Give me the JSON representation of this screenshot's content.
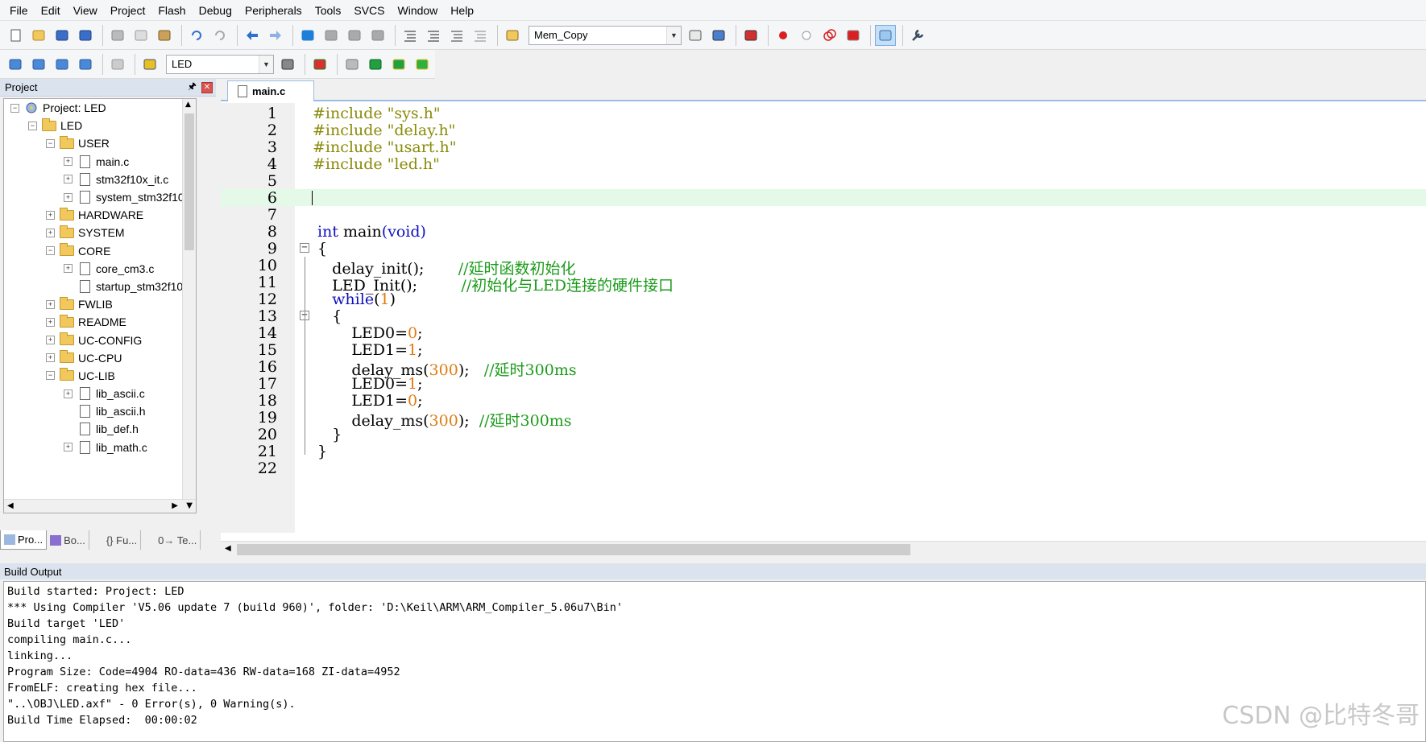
{
  "menu": [
    "File",
    "Edit",
    "View",
    "Project",
    "Flash",
    "Debug",
    "Peripherals",
    "Tools",
    "SVCS",
    "Window",
    "Help"
  ],
  "toolbar1": {
    "icons": [
      "new-file-icon",
      "open-icon",
      "save-icon",
      "save-all-icon",
      "cut-icon",
      "copy-icon",
      "paste-icon",
      "undo-icon",
      "redo-icon",
      "nav-back-icon",
      "nav-forward-icon",
      "bookmark-icon",
      "prev-bookmark-icon",
      "next-bookmark-icon",
      "clear-bookmarks-icon",
      "indent-icon",
      "unindent-icon",
      "comment-icon",
      "uncomment-icon",
      "find-in-files-icon"
    ],
    "find_combo": "Mem_Copy",
    "icons2": [
      "incremental-find-icon",
      "browse-icon",
      "debug-session-icon",
      "breakpoint-icon",
      "disable-breakpoint-icon",
      "disable-all-breakpoints-icon",
      "kill-breakpoints-icon",
      "window-layout-icon",
      "configure-icon"
    ]
  },
  "toolbar2": {
    "icons": [
      "translate-icon",
      "build-icon",
      "rebuild-icon",
      "batch-build-icon",
      "stop-build-icon",
      "download-icon"
    ],
    "target_combo": "LED",
    "icons2": [
      "target-options-icon",
      "manage-components-icon",
      "pack-installer-icon",
      "select-packs-icon",
      "event-recorder-icon",
      "green-diamond-icon"
    ]
  },
  "project": {
    "title": "Project",
    "pin": "⎐",
    "close": "✕",
    "tree": [
      {
        "label": "Project: LED",
        "level": 0,
        "type": "project",
        "exp": "−"
      },
      {
        "label": "LED",
        "level": 1,
        "type": "target",
        "exp": "−"
      },
      {
        "label": "USER",
        "level": 2,
        "type": "folder",
        "exp": "−"
      },
      {
        "label": "main.c",
        "level": 3,
        "type": "file",
        "exp": "+"
      },
      {
        "label": "stm32f10x_it.c",
        "level": 3,
        "type": "file",
        "exp": "+"
      },
      {
        "label": "system_stm32f10",
        "level": 3,
        "type": "file",
        "exp": "+"
      },
      {
        "label": "HARDWARE",
        "level": 2,
        "type": "folder",
        "exp": "+"
      },
      {
        "label": "SYSTEM",
        "level": 2,
        "type": "folder",
        "exp": "+"
      },
      {
        "label": "CORE",
        "level": 2,
        "type": "folder",
        "exp": "−"
      },
      {
        "label": "core_cm3.c",
        "level": 3,
        "type": "file",
        "exp": "+"
      },
      {
        "label": "startup_stm32f10",
        "level": 3,
        "type": "file",
        "exp": ""
      },
      {
        "label": "FWLIB",
        "level": 2,
        "type": "folder",
        "exp": "+"
      },
      {
        "label": "README",
        "level": 2,
        "type": "folder",
        "exp": "+"
      },
      {
        "label": "UC-CONFIG",
        "level": 2,
        "type": "folder",
        "exp": "+"
      },
      {
        "label": "UC-CPU",
        "level": 2,
        "type": "folder",
        "exp": "+"
      },
      {
        "label": "UC-LIB",
        "level": 2,
        "type": "folder",
        "exp": "−"
      },
      {
        "label": "lib_ascii.c",
        "level": 3,
        "type": "file",
        "exp": "+"
      },
      {
        "label": "lib_ascii.h",
        "level": 3,
        "type": "file",
        "exp": ""
      },
      {
        "label": "lib_def.h",
        "level": 3,
        "type": "file",
        "exp": ""
      },
      {
        "label": "lib_math.c",
        "level": 3,
        "type": "file",
        "exp": "+"
      }
    ],
    "tabs": [
      "Pro...",
      "Bo...",
      "{} Fu...",
      "0→ Te..."
    ]
  },
  "editor": {
    "tab": "main.c",
    "current_line": 6,
    "lines": [
      [
        [
          "pp",
          "#include "
        ],
        [
          "str",
          "\"sys.h\""
        ]
      ],
      [
        [
          "pp",
          "#include "
        ],
        [
          "str",
          "\"delay.h\""
        ]
      ],
      [
        [
          "pp",
          "#include "
        ],
        [
          "str",
          "\"usart.h\""
        ]
      ],
      [
        [
          "pp",
          "#include "
        ],
        [
          "str",
          "\"led.h\""
        ]
      ],
      [],
      [],
      [],
      [
        [
          "nm",
          " "
        ],
        [
          "kw",
          "int"
        ],
        [
          "nm",
          " main"
        ],
        [
          "kw",
          "(void)"
        ]
      ],
      [
        [
          "nm",
          " {"
        ]
      ],
      [
        [
          "nm",
          "    delay_init();       "
        ],
        [
          "cm",
          "//延时函数初始化"
        ]
      ],
      [
        [
          "nm",
          "    LED_Init();         "
        ],
        [
          "cm",
          "//初始化与LED连接的硬件接口"
        ]
      ],
      [
        [
          "nm",
          "    "
        ],
        [
          "kw",
          "while"
        ],
        [
          "nm",
          "("
        ],
        [
          "num",
          "1"
        ],
        [
          "nm",
          ")"
        ]
      ],
      [
        [
          "nm",
          "    {"
        ]
      ],
      [
        [
          "nm",
          "        LED0="
        ],
        [
          "num",
          "0"
        ],
        [
          "nm",
          ";"
        ]
      ],
      [
        [
          "nm",
          "        LED1="
        ],
        [
          "num",
          "1"
        ],
        [
          "nm",
          ";"
        ]
      ],
      [
        [
          "nm",
          "        delay_ms("
        ],
        [
          "num",
          "300"
        ],
        [
          "nm",
          ");   "
        ],
        [
          "cm",
          "//延时300ms"
        ]
      ],
      [
        [
          "nm",
          "        LED0="
        ],
        [
          "num",
          "1"
        ],
        [
          "nm",
          ";"
        ]
      ],
      [
        [
          "nm",
          "        LED1="
        ],
        [
          "num",
          "0"
        ],
        [
          "nm",
          ";"
        ]
      ],
      [
        [
          "nm",
          "        delay_ms("
        ],
        [
          "num",
          "300"
        ],
        [
          "nm",
          ");  "
        ],
        [
          "cm",
          "//延时300ms"
        ]
      ],
      [
        [
          "nm",
          "    }"
        ]
      ],
      [
        [
          "nm",
          " }"
        ]
      ],
      []
    ]
  },
  "build_output": {
    "title": "Build Output",
    "lines": [
      "Build started: Project: LED",
      "*** Using Compiler 'V5.06 update 7 (build 960)', folder: 'D:\\Keil\\ARM\\ARM_Compiler_5.06u7\\Bin'",
      "Build target 'LED'",
      "compiling main.c...",
      "linking...",
      "Program Size: Code=4904 RO-data=436 RW-data=168 ZI-data=4952",
      "FromELF: creating hex file...",
      "\"..\\OBJ\\LED.axf\" - 0 Error(s), 0 Warning(s).",
      "Build Time Elapsed:  00:00:02"
    ]
  },
  "watermark": "CSDN @比特冬哥"
}
